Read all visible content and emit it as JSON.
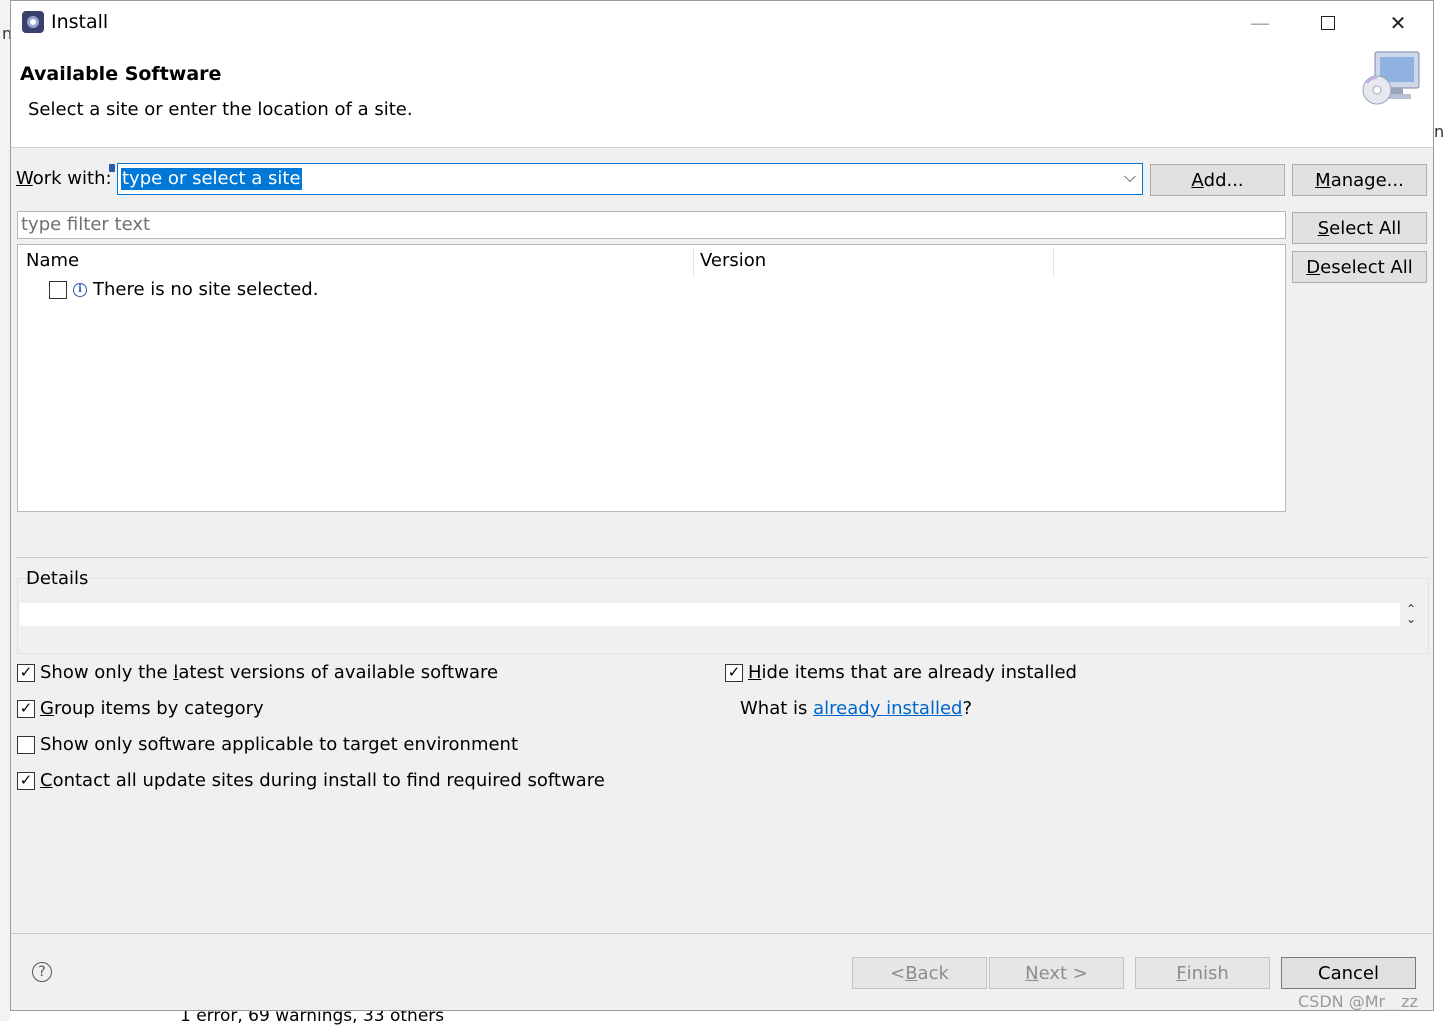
{
  "window": {
    "title": "Install"
  },
  "header": {
    "title": "Available Software",
    "description": "Select a site or enter the location of a site."
  },
  "work_with": {
    "label_underlined": "W",
    "label_rest": "ork with:",
    "value": "type or select a site"
  },
  "buttons": {
    "add": {
      "u": "A",
      "rest": "dd..."
    },
    "manage": {
      "u": "M",
      "rest": "anage..."
    },
    "select_all": {
      "u": "S",
      "rest": "elect All"
    },
    "deselect_all": {
      "u": "D",
      "rest": "eselect All"
    }
  },
  "filter": {
    "placeholder": "type filter text"
  },
  "tree": {
    "columns": [
      "Name",
      "Version"
    ],
    "rows": [
      {
        "checked": false,
        "label": "There is no site selected."
      }
    ]
  },
  "details": {
    "label": "Details"
  },
  "options": {
    "latest": {
      "checked": true,
      "before": "Show only the ",
      "u": "l",
      "after": "atest versions of available software"
    },
    "group": {
      "checked": true,
      "before": "",
      "u": "G",
      "after": "roup items by category"
    },
    "applicable": {
      "checked": false,
      "before": "Show only software applicable to target environment",
      "u": "",
      "after": ""
    },
    "contact": {
      "checked": true,
      "before": "",
      "u": "C",
      "after": "ontact all update sites during install to find required software"
    },
    "hide": {
      "checked": true,
      "before": "",
      "u": "H",
      "after": "ide items that are already installed"
    }
  },
  "what_is": {
    "prefix": "What is ",
    "link": "already installed",
    "suffix": "?"
  },
  "footer": {
    "back": {
      "prefix": "< ",
      "u": "B",
      "rest": "ack"
    },
    "next": {
      "u": "N",
      "rest": "ext >"
    },
    "finish": {
      "u": "F",
      "rest": "inish"
    },
    "cancel": "Cancel"
  },
  "background": {
    "status_text": "1 error, 69 warnings, 33 others",
    "left_fragment": "n",
    "right_fragment": "n"
  },
  "watermark": "CSDN @Mr__zz",
  "icons": {
    "app": "eclipse-icon",
    "header": "install-monitor-cd-icon",
    "info": "info-icon",
    "help": "help-icon"
  }
}
